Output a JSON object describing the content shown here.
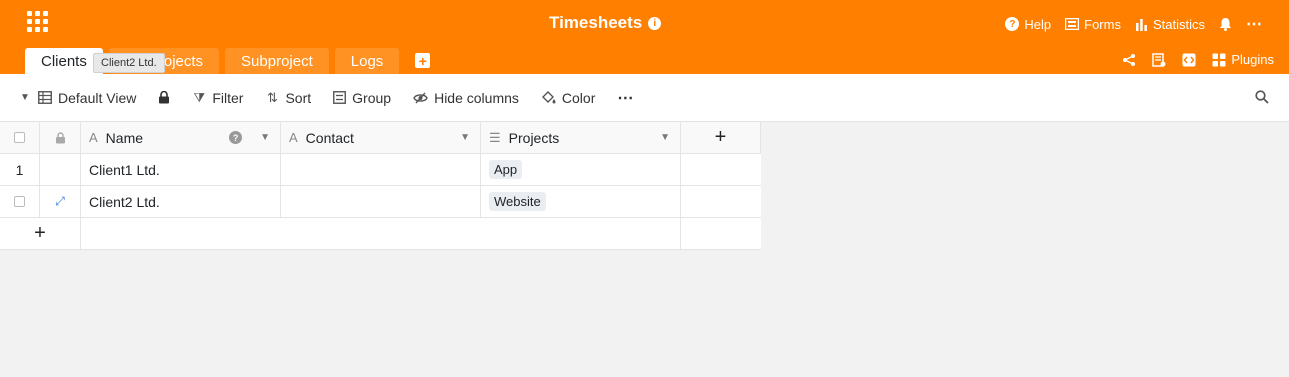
{
  "app": {
    "title": "Timesheets",
    "accent": "#ff8000"
  },
  "header": {
    "help": "Help",
    "forms": "Forms",
    "statistics": "Statistics"
  },
  "tabs": [
    {
      "label": "Clients",
      "active": true
    },
    {
      "label": "Projects",
      "active": false
    },
    {
      "label": "Subproject",
      "active": false
    },
    {
      "label": "Logs",
      "active": false
    }
  ],
  "tooltip": "Client2 Ltd.",
  "tabs_right": {
    "plugins": "Plugins"
  },
  "toolbar": {
    "view": "Default View",
    "filter": "Filter",
    "sort": "Sort",
    "group": "Group",
    "hide_columns": "Hide columns",
    "color": "Color"
  },
  "table": {
    "columns": [
      {
        "name": "Name",
        "type_icon": "text-icon"
      },
      {
        "name": "Contact",
        "type_icon": "text-icon"
      },
      {
        "name": "Projects",
        "type_icon": "link-icon"
      }
    ],
    "rows": [
      {
        "index": "1",
        "name": "Client1 Ltd.",
        "contact": "",
        "project": "App"
      },
      {
        "index": "",
        "name": "Client2 Ltd.",
        "contact": "",
        "project": "Website"
      }
    ]
  }
}
